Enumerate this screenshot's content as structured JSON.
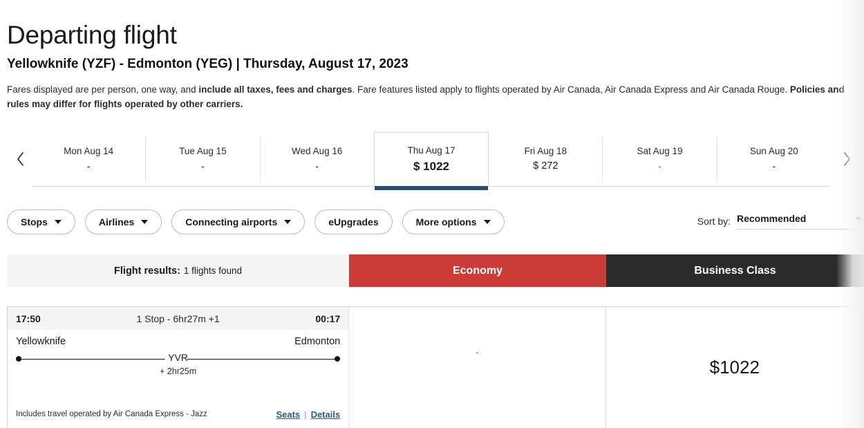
{
  "page": {
    "title": "Departing flight",
    "route_heading": "Yellowknife (YZF) - Edmonton (YEG) | Thursday, August 17, 2023",
    "disclaimer_1": "Fares displayed are per person, one way, and ",
    "disclaimer_1_bold": "include all taxes, fees and charges",
    "disclaimer_2": ". Fare features listed apply to flights operated by Air Canada, Air Canada Express and Air Canada Rouge. ",
    "disclaimer_2_bold": "Policies and rules may differ for flights operated by other carriers."
  },
  "date_strip": {
    "prev_label": "‹",
    "next_label": "›",
    "days": [
      {
        "label": "Mon Aug 14",
        "fare": "-",
        "selected": false,
        "fare_color": "black"
      },
      {
        "label": "Tue Aug 15",
        "fare": "-",
        "selected": false,
        "fare_color": "black"
      },
      {
        "label": "Wed Aug 16",
        "fare": "-",
        "selected": false,
        "fare_color": "black"
      },
      {
        "label": "Thu Aug 17",
        "fare": "$ 1022",
        "selected": true,
        "fare_color": "black"
      },
      {
        "label": "Fri Aug 18",
        "fare": "$ 272",
        "selected": false,
        "fare_color": "black"
      },
      {
        "label": "Sat Aug 19",
        "fare": "-",
        "selected": false,
        "fare_color": "green"
      },
      {
        "label": "Sun Aug 20",
        "fare": "-",
        "selected": false,
        "fare_color": "black"
      }
    ],
    "selected_accent": "#1f4e79",
    "green_accent": "#2f8f37"
  },
  "filters": [
    {
      "label": "Stops",
      "has_caret": true
    },
    {
      "label": "Airlines",
      "has_caret": true
    },
    {
      "label": "Connecting airports",
      "has_caret": true
    },
    {
      "label": "eUpgrades",
      "has_caret": false
    },
    {
      "label": "More options",
      "has_caret": true
    }
  ],
  "sort": {
    "label": "Sort by:",
    "value": "Recommended"
  },
  "results_header": {
    "results_label": "Flight results:",
    "results_count": "1 flights found",
    "economy_label": "Economy",
    "business_label": "Business Class",
    "economy_color": "#cb3c37",
    "business_color": "#2b2b2b"
  },
  "flights": [
    {
      "depart_time": "17:50",
      "summary": "1 Stop - 6hr27m +1",
      "arrive_time": "00:17",
      "origin": "Yellowknife",
      "destination": "Edmonton",
      "stop_code": "YVR",
      "layover": "+ 2hr25m",
      "operated_by": "Includes travel operated by Air Canada Express - Jazz",
      "seats_link": "Seats",
      "link_separator": "|",
      "details_link": "Details",
      "economy_fare": "-",
      "business_fare": "$1022"
    }
  ]
}
